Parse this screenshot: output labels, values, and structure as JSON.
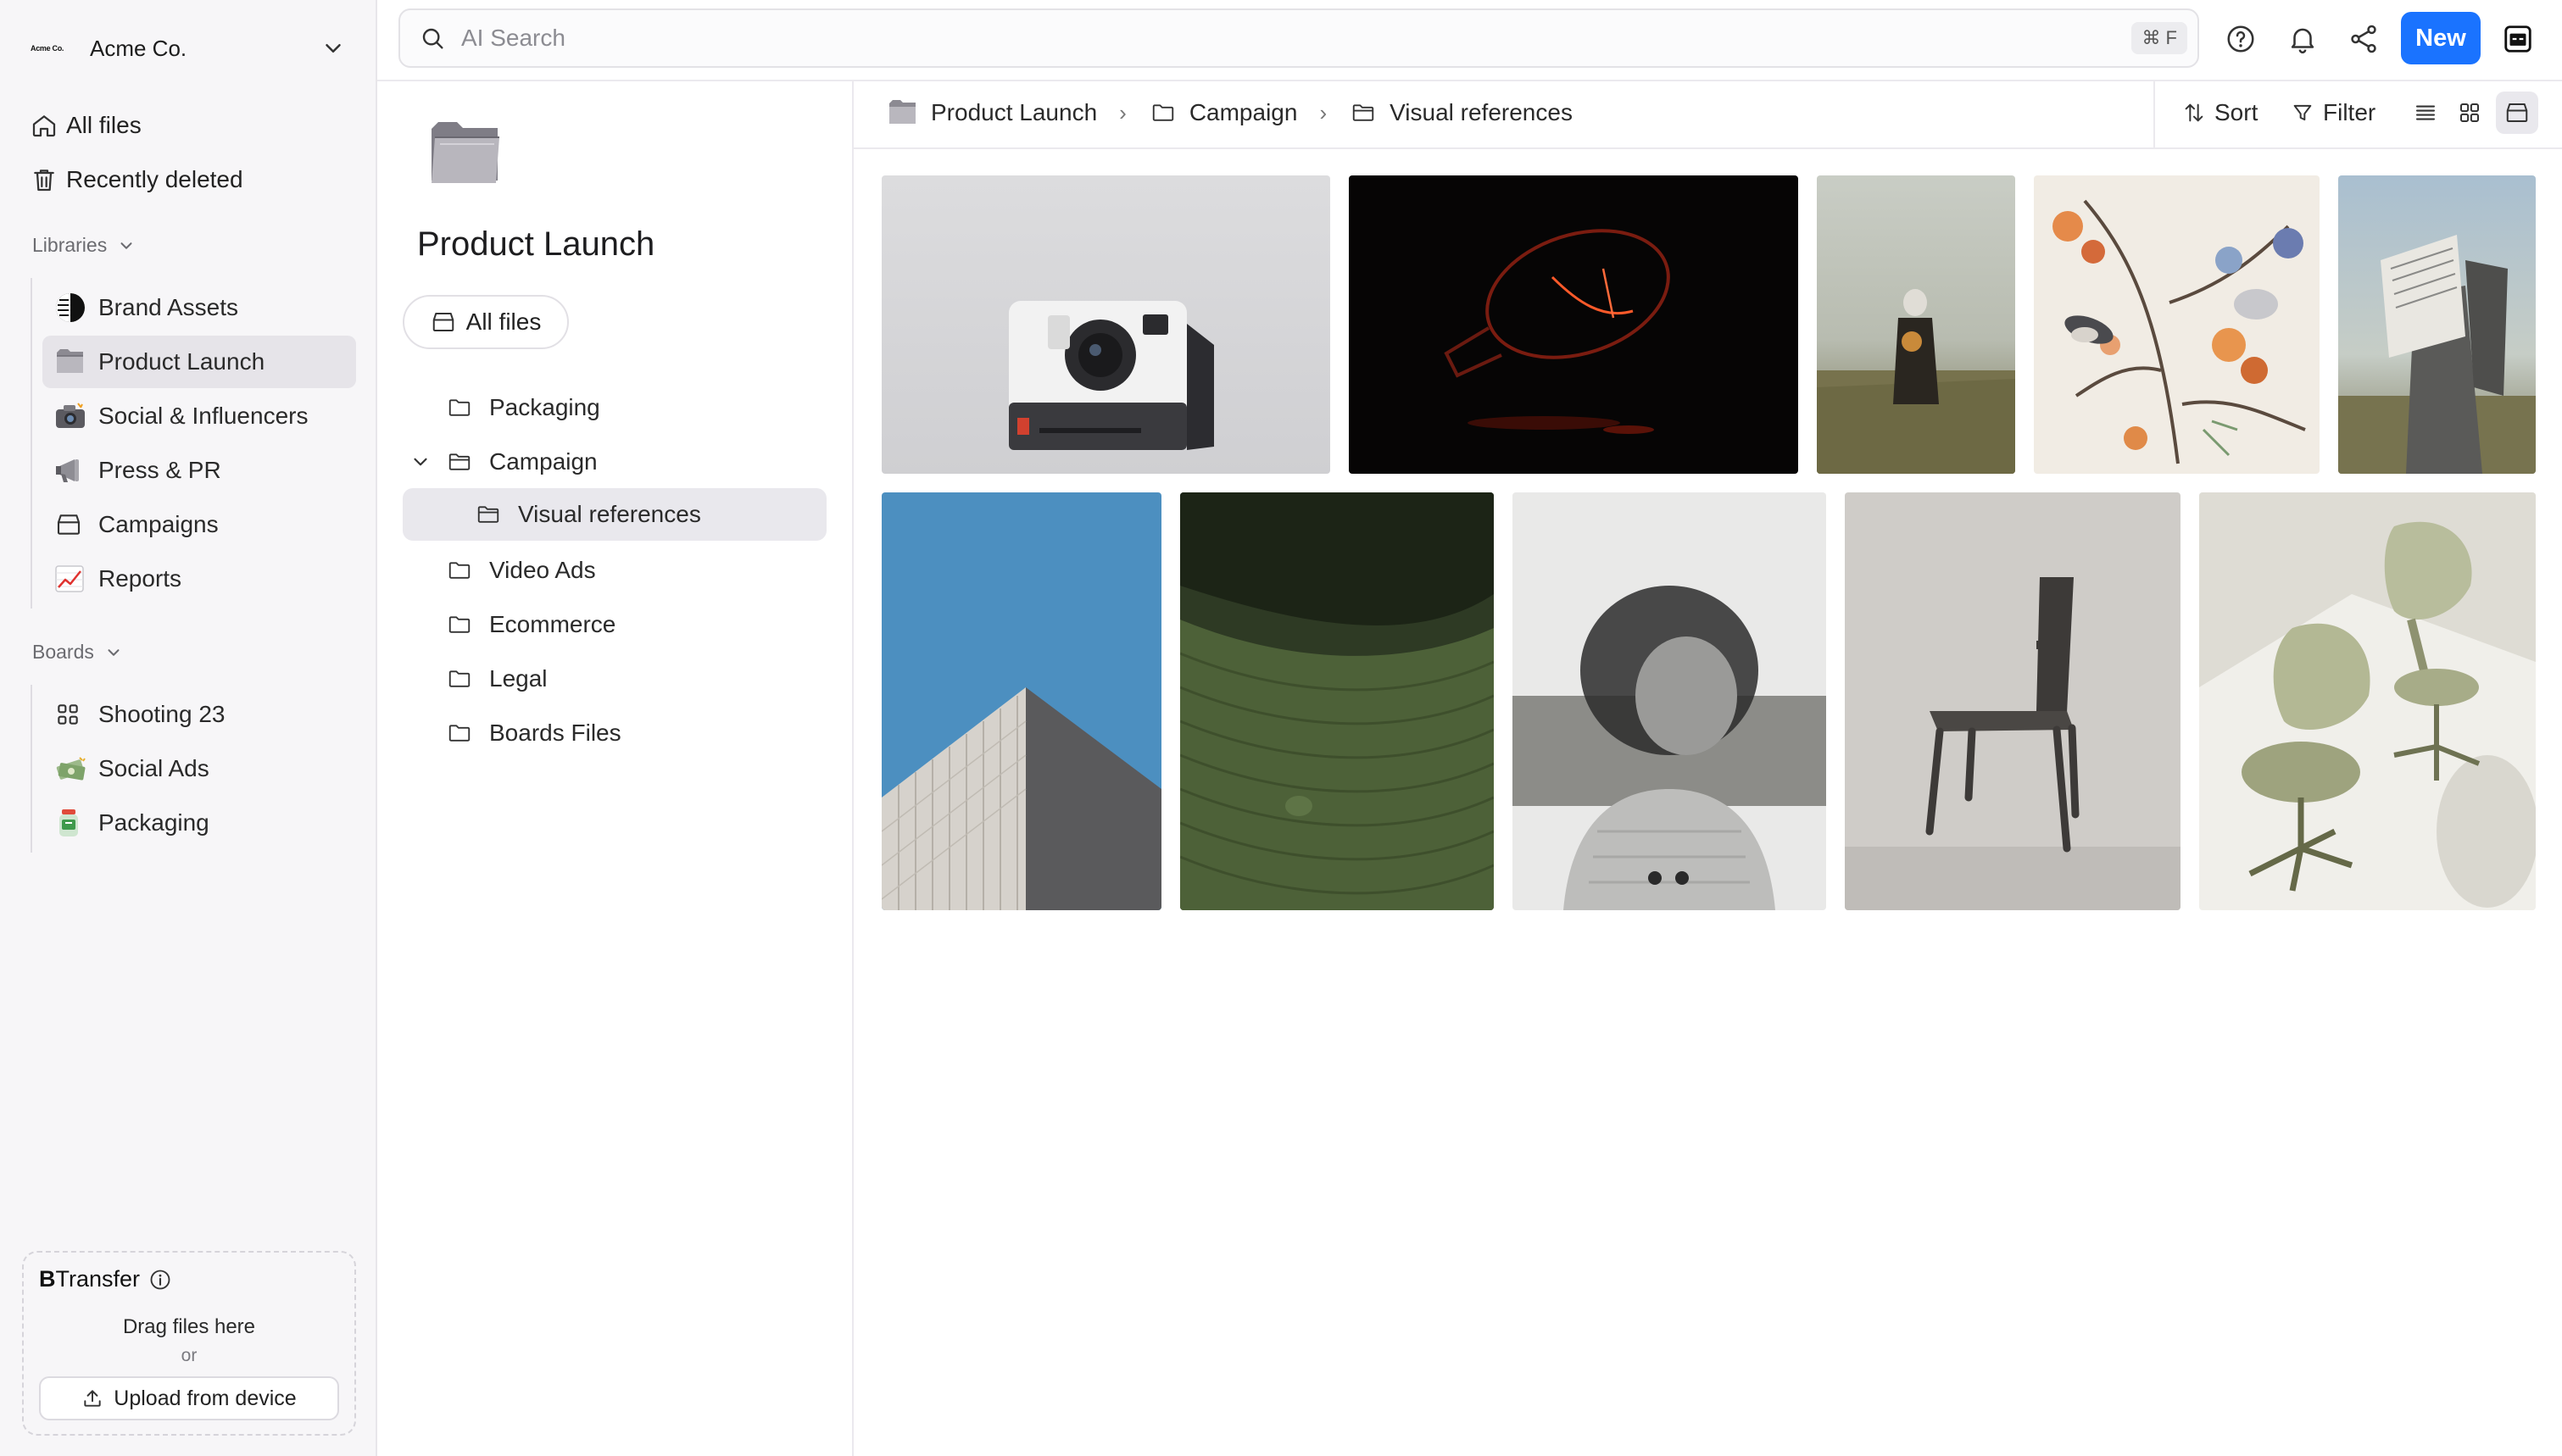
{
  "workspace": {
    "logo_text": "Acme Co.",
    "name": "Acme Co."
  },
  "nav": {
    "all_files": "All files",
    "recently_deleted": "Recently deleted"
  },
  "libraries": {
    "label": "Libraries",
    "items": [
      {
        "label": "Brand Assets",
        "icon": "half-circle-icon"
      },
      {
        "label": "Product Launch",
        "icon": "folder-icon",
        "active": true
      },
      {
        "label": "Social & Influencers",
        "icon": "camera-emoji-icon"
      },
      {
        "label": "Press & PR",
        "icon": "megaphone-emoji-icon"
      },
      {
        "label": "Campaigns",
        "icon": "archive-box-icon"
      },
      {
        "label": "Reports",
        "icon": "chart-emoji-icon"
      }
    ]
  },
  "boards": {
    "label": "Boards",
    "items": [
      {
        "label": "Shooting 23",
        "icon": "grid-icon"
      },
      {
        "label": "Social Ads",
        "icon": "money-emoji-icon"
      },
      {
        "label": "Packaging",
        "icon": "jar-emoji-icon"
      }
    ]
  },
  "transfer": {
    "title_bold": "B",
    "title_rest": "Transfer",
    "drag": "Drag files here",
    "or": "or",
    "upload": "Upload from device"
  },
  "search": {
    "placeholder": "AI Search",
    "shortcut": "⌘ F"
  },
  "topbar": {
    "new_label": "New"
  },
  "folder_panel": {
    "title": "Product Launch",
    "all_files": "All files",
    "tree": [
      {
        "label": "Packaging",
        "indent": 0
      },
      {
        "label": "Campaign",
        "indent": 0,
        "expanded": true
      },
      {
        "label": "Visual references",
        "indent": 1,
        "active": true
      },
      {
        "label": "Video Ads",
        "indent": 0
      },
      {
        "label": "Ecommerce",
        "indent": 0
      },
      {
        "label": "Legal",
        "indent": 0
      },
      {
        "label": "Boards Files",
        "indent": 0
      }
    ]
  },
  "breadcrumb": [
    "Product Launch",
    "Campaign",
    "Visual references"
  ],
  "toolbar": {
    "sort": "Sort",
    "filter": "Filter"
  },
  "assets": [
    {
      "name": "instant-camera"
    },
    {
      "name": "glowing-lightbulb"
    },
    {
      "name": "figure-in-field"
    },
    {
      "name": "botanical-birds-illustration"
    },
    {
      "name": "person-reading-newspaper"
    },
    {
      "name": "building-corner-sky"
    },
    {
      "name": "green-corduroy-cushion"
    },
    {
      "name": "blurred-portrait"
    },
    {
      "name": "dark-chair"
    },
    {
      "name": "green-office-chairs"
    }
  ],
  "colors": {
    "accent": "#1a73ff",
    "sidebar_bg": "#f7f6f8",
    "active_bg": "#e6e4e9"
  }
}
